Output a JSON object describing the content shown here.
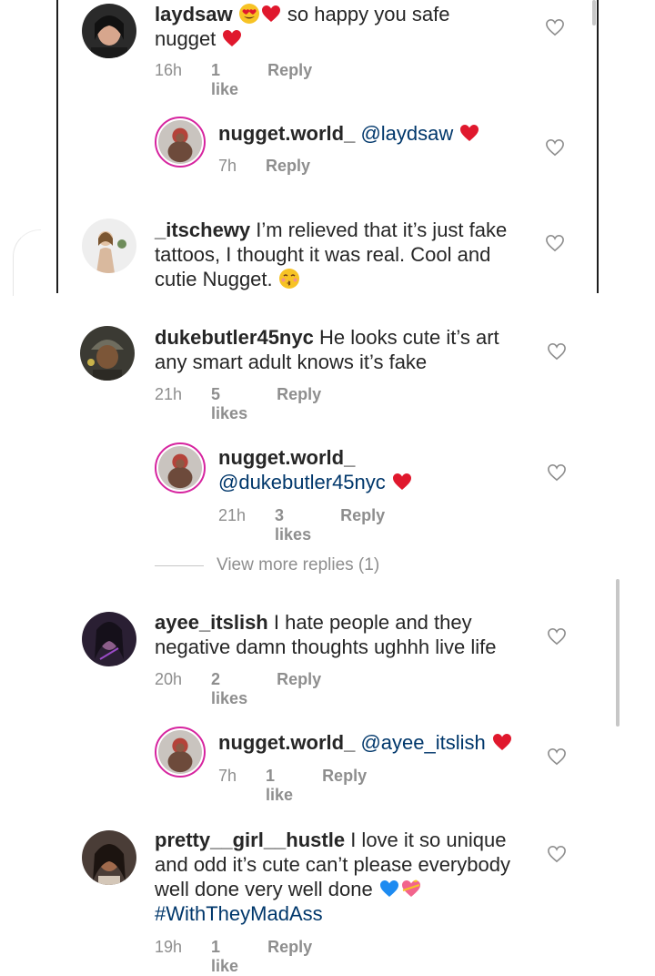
{
  "comments": [
    {
      "username": "laydsaw",
      "text_after_emoji": "so happy you safe",
      "text_line2": "nugget",
      "time": "16h",
      "likes": "1 like",
      "reply": "Reply"
    },
    {
      "username": "nugget.world_",
      "mention": "@laydsaw",
      "time": "7h",
      "reply": "Reply"
    },
    {
      "username": "_itschewy",
      "text_l1": "I’m relieved that it’s just fake",
      "text_l2": "tattoos, I thought it was real. Cool and",
      "text_l3": "cutie Nugget."
    },
    {
      "username": "dukebutler45nyc",
      "text_l1": "He looks cute it’s art",
      "text_l2": "any smart adult knows it’s fake",
      "time": "21h",
      "likes": "5 likes",
      "reply": "Reply"
    },
    {
      "username": "nugget.world_",
      "mention": "@dukebutler45nyc",
      "time": "21h",
      "likes": "3 likes",
      "reply": "Reply"
    },
    {
      "username": "ayee_itslish",
      "text_l1": "I hate people and they",
      "text_l2": "negative damn thoughts ughhh live life",
      "time": "20h",
      "likes": "2 likes",
      "reply": "Reply"
    },
    {
      "username": "nugget.world_",
      "mention": "@ayee_itslish",
      "time": "7h",
      "likes": "1 like",
      "reply": "Reply"
    },
    {
      "username": "pretty__girl__hustle",
      "text_l1": "I love it so unique",
      "text_l2": "and odd it’s cute can’t please everybody",
      "text_l3": "well done very well done",
      "hashtag": "#WithTheyMadAss",
      "time": "19h",
      "likes": "1 like",
      "reply": "Reply"
    }
  ],
  "view_more": "View more replies (1)",
  "colors": {
    "heart_red": "#e0182d",
    "link_blue": "#00376b",
    "meta_gray": "#8e8e8e",
    "story_ring": "#d6249f"
  },
  "icons": [
    "heart-outline-icon",
    "red-heart-emoji",
    "heart-eyes-emoji",
    "kissing-emoji",
    "blue-heart-emoji",
    "gift-heart-emoji"
  ]
}
